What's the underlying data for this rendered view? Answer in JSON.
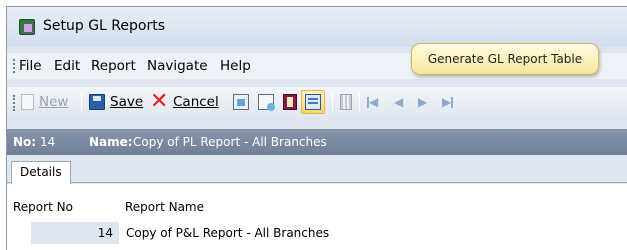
{
  "window": {
    "title": "Setup GL Reports"
  },
  "menu": [
    "File",
    "Edit",
    "Report",
    "Navigate",
    "Help"
  ],
  "toolbar": {
    "new_label": "New",
    "save_label": "Save",
    "cancel_label": "Cancel",
    "icons": [
      "new-icon",
      "save-icon",
      "cancel-icon",
      "generate-report-icon",
      "generate-report-2-icon",
      "book-icon",
      "generate-table-icon",
      "delete-icon",
      "first-record-icon",
      "prev-record-icon",
      "next-record-icon",
      "last-record-icon"
    ]
  },
  "tooltip": {
    "text": "Generate GL Report Table"
  },
  "record": {
    "no_label": "No:",
    "no_value": "14",
    "name_label": "Name:",
    "name_value": "Copy of PL Report - All Branches"
  },
  "tabs": [
    {
      "label": "Details",
      "active": true
    }
  ],
  "table": {
    "columns": [
      "Report No",
      "Report Name"
    ],
    "rows": [
      {
        "report_no": "14",
        "report_name": "Copy of P&L Report - All Branches"
      }
    ]
  },
  "colors": {
    "accent": "#6f7f96",
    "tooltip_bg": "#fff3c4",
    "cancel_red": "#e0221b",
    "highlight": "#ffd36b"
  }
}
